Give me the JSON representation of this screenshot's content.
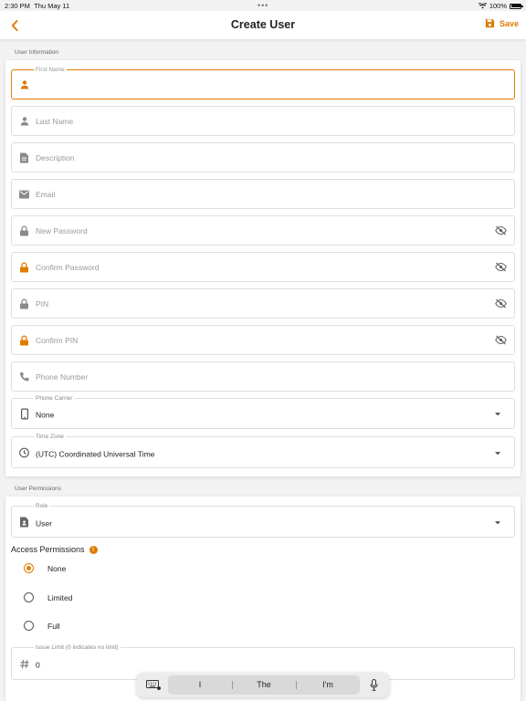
{
  "status_bar": {
    "time": "2:30 PM",
    "date": "Thu May 11",
    "battery": "100%",
    "battery_level": 1.0
  },
  "nav": {
    "title": "Create User",
    "save_label": "Save",
    "back_icon": "chevron-left-icon",
    "save_icon": "floppy-disk-icon"
  },
  "colors": {
    "accent": "#de7c00",
    "icon_gray": "#8a8a8a",
    "background": "#f2f2f2"
  },
  "user_information": {
    "header": "User Information",
    "first_name": {
      "label": "First Name",
      "value": "",
      "icon": "person-icon"
    },
    "last_name": {
      "placeholder": "Last Name",
      "icon": "person-icon"
    },
    "description": {
      "placeholder": "Description",
      "icon": "document-icon"
    },
    "email": {
      "placeholder": "Email",
      "icon": "mail-icon"
    },
    "new_password": {
      "placeholder": "New Password",
      "icon": "lock-icon"
    },
    "confirm_password": {
      "placeholder": "Confirm Password",
      "icon": "lock-icon"
    },
    "pin": {
      "placeholder": "PIN",
      "icon": "lock-icon"
    },
    "confirm_pin": {
      "placeholder": "Confirm PIN",
      "icon": "lock-icon"
    },
    "phone_number": {
      "placeholder": "Phone Number",
      "icon": "phone-icon"
    },
    "phone_carrier": {
      "label": "Phone Carrier",
      "value": "None",
      "icon": "mobile-icon"
    },
    "time_zone": {
      "label": "Time Zone",
      "value": "(UTC) Coordinated Universal Time",
      "icon": "clock-icon"
    }
  },
  "user_permissions": {
    "header": "User Permissions",
    "role": {
      "label": "Role",
      "value": "User",
      "icon": "badge-icon"
    },
    "access_permissions": {
      "title": "Access Permissions",
      "info": "!",
      "options": [
        {
          "label": "None",
          "checked": true
        },
        {
          "label": "Limited",
          "checked": false
        },
        {
          "label": "Full",
          "checked": false
        }
      ]
    },
    "issue_limit": {
      "label": "Issue Limit (0 indicates no limit)",
      "value": "0",
      "icon": "hash-icon"
    }
  },
  "keyboard_suggestions": {
    "items": [
      "I",
      "The",
      "I'm"
    ]
  }
}
